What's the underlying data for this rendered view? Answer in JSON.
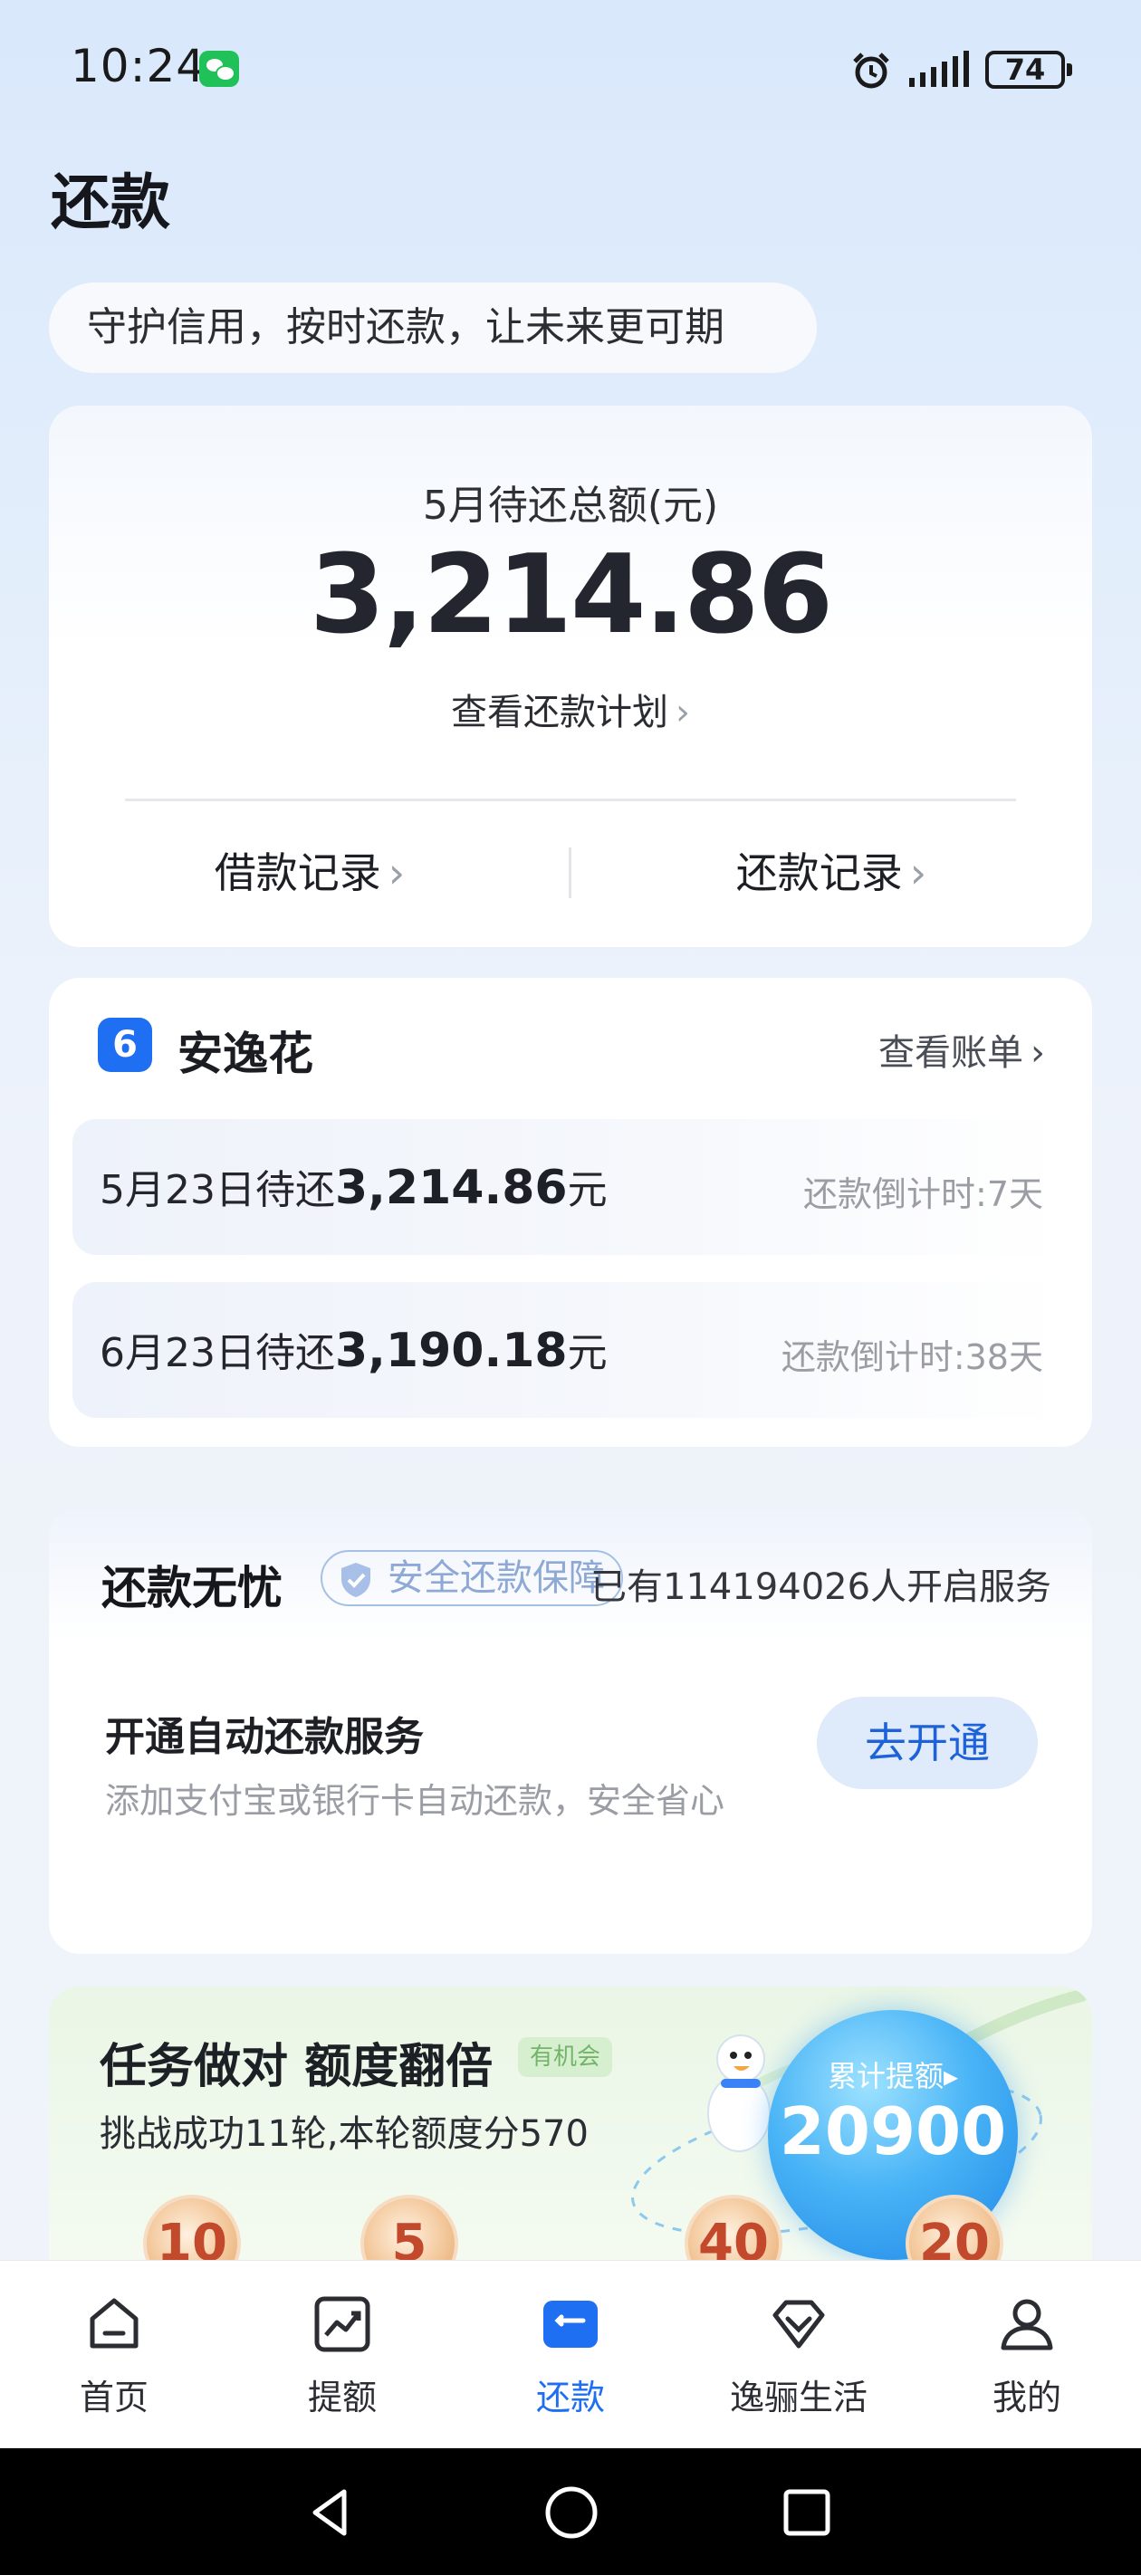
{
  "status_bar": {
    "time": "10:24",
    "battery": "74"
  },
  "header": {
    "title": "还款",
    "slogan": "守护信用，按时还款，让未来更可期"
  },
  "summary": {
    "label": "5月待还总额(元)",
    "amount": "3,214.86",
    "plan_link": "查看还款计划",
    "borrow_records": "借款记录",
    "repay_records": "还款记录"
  },
  "anyihua": {
    "logo_glyph": "6",
    "name": "安逸花",
    "bill_link": "查看账单",
    "dues": [
      {
        "date_text": "5月23日待还",
        "amount": "3,214.86",
        "unit": "元",
        "countdown": "还款倒计时:7天"
      },
      {
        "date_text": "6月23日待还",
        "amount": "3,190.18",
        "unit": "元",
        "countdown": "还款倒计时:38天"
      }
    ]
  },
  "worry_free": {
    "title": "还款无忧",
    "badge": "安全还款保障",
    "users": "已有114194026人开启服务",
    "auto_title": "开通自动还款服务",
    "auto_desc": "添加支付宝或银行卡自动还款，安全省心",
    "enable_button": "去开通"
  },
  "task": {
    "title": "任务做对 额度翻倍",
    "tag": "有机会",
    "desc": "挑战成功11轮,本轮额度分570",
    "orb_label": "累计提额▸",
    "orb_value": "20900",
    "coins": [
      "10",
      "5",
      "40",
      "20"
    ]
  },
  "tabs": [
    {
      "label": "首页",
      "icon": "home-icon"
    },
    {
      "label": "提额",
      "icon": "chart-up-icon"
    },
    {
      "label": "还款",
      "icon": "repay-card-icon"
    },
    {
      "label": "逸骊生活",
      "icon": "diamond-icon"
    },
    {
      "label": "我的",
      "icon": "person-icon"
    }
  ],
  "colors": {
    "accent": "#1f6ff2",
    "brand_green": "#21c15a"
  }
}
